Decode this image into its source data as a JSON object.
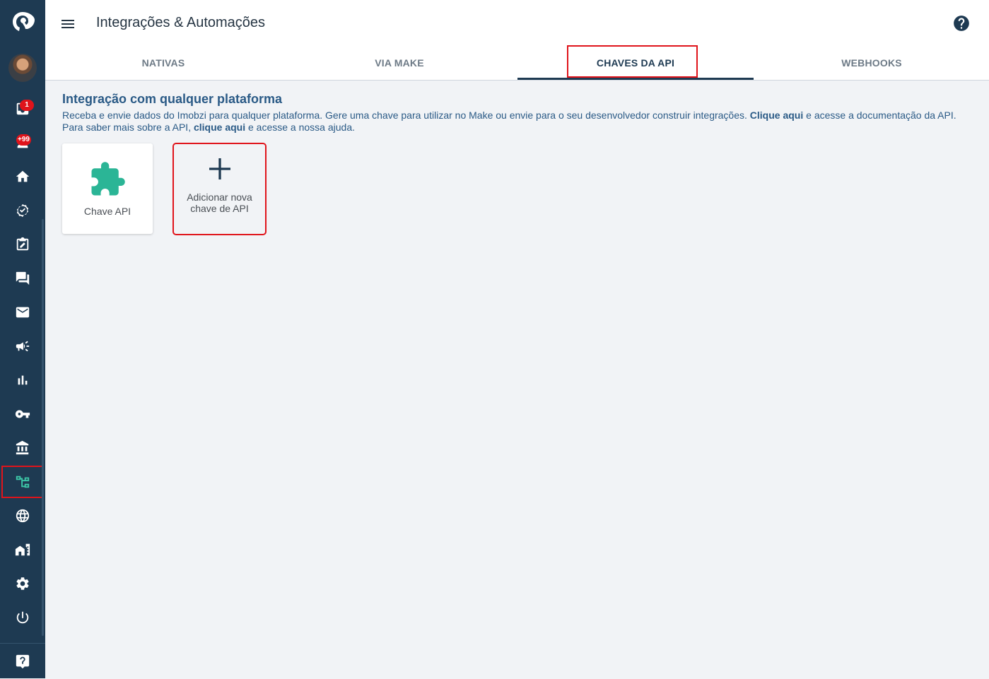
{
  "header": {
    "title": "Integrações & Automações"
  },
  "tabs": [
    {
      "label": "NATIVAS"
    },
    {
      "label": "VIA MAKE"
    },
    {
      "label": "CHAVES DA API"
    },
    {
      "label": "WEBHOOKS"
    }
  ],
  "active_tab": "CHAVES DA API",
  "sidebar": {
    "badges": {
      "notifications": "1",
      "leads": "+99"
    },
    "items": [
      "logo",
      "avatar",
      "inbox",
      "leads",
      "home",
      "tasks",
      "edit",
      "chat",
      "email",
      "campaigns",
      "reports",
      "keys",
      "bank",
      "integrations",
      "site",
      "properties",
      "settings",
      "logout",
      "help"
    ],
    "active_item": "integrations"
  },
  "main": {
    "title": "Integração com qualquer plataforma",
    "description_part1": "Receba e envie dados do Imobzi para qualquer plataforma. Gere uma chave para utilizar no Make ou envie para o seu desenvolvedor construir integrações.",
    "link1": "Clique aqui",
    "description_part2": "e acesse a documentação da API. Para saber mais sobre a API,",
    "link2": "clique aqui",
    "description_part3": "e acesse a nossa ajuda.",
    "cards": [
      {
        "label": "Chave API",
        "icon": "puzzle-icon"
      },
      {
        "label_line1": "Adicionar nova",
        "label_line2": "chave de API",
        "icon": "plus-icon"
      }
    ]
  },
  "colors": {
    "sidebar": "#1e3a52",
    "accent": "#2bb596",
    "highlight": "#e0141b",
    "title": "#2a5a86"
  }
}
